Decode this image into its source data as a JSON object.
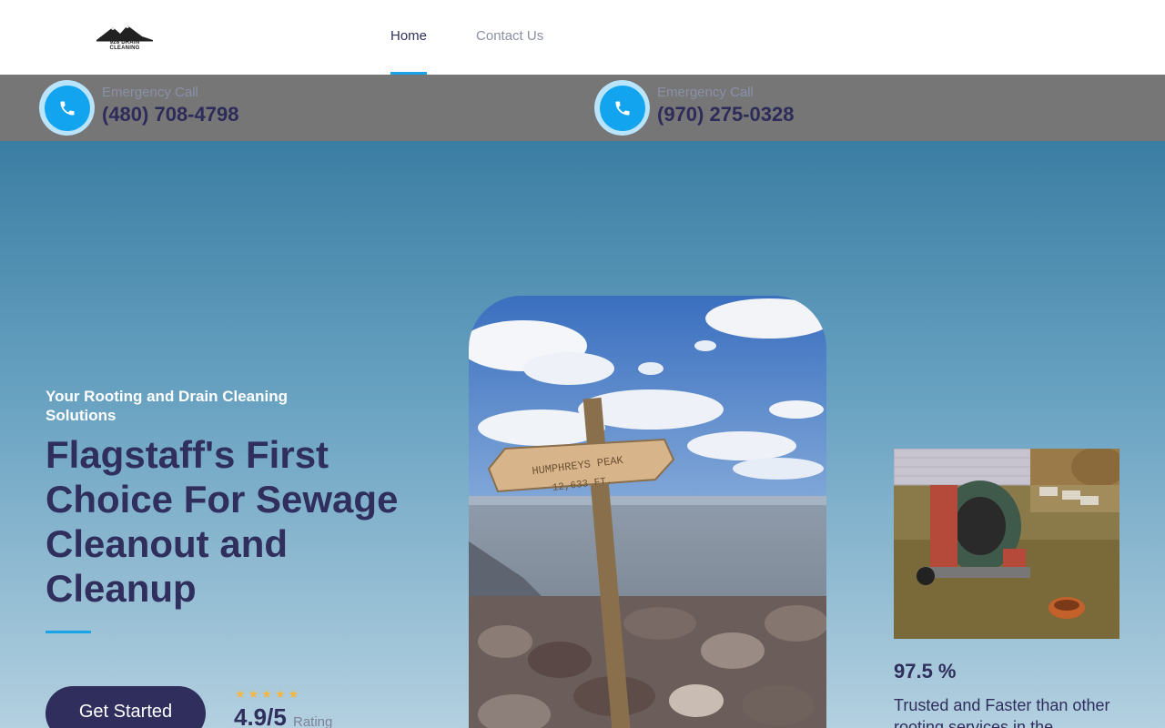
{
  "header": {
    "logo_text": "928 DRAIN CLEANING",
    "nav": [
      {
        "label": "Home",
        "active": true
      },
      {
        "label": "Contact Us",
        "active": false
      }
    ]
  },
  "emergency": [
    {
      "label": "Emergency Call",
      "phone": "(480) 708-4798",
      "icon": "phone-icon"
    },
    {
      "label": "Emergency Call",
      "phone": "(970) 275-0328",
      "icon": "phone-icon"
    }
  ],
  "hero": {
    "subtitle": "Your Rooting and Drain Cleaning Solutions",
    "headline": "Flagstaff's First Choice For Sewage Cleanout and Cleanup",
    "cta_label": "Get Started",
    "rating": {
      "stars": "★★★★★",
      "value": "4.9/5",
      "label": "Rating"
    },
    "main_image_sign": {
      "line1": "HUMPHREYS PEAK",
      "line2": "12,633 FT."
    },
    "stat": {
      "value": "97.5 %",
      "text": "Trusted and Faster than other rooting services in the"
    }
  },
  "colors": {
    "brand_dark": "#2f2e5c",
    "accent_blue": "#1aa3e8",
    "emergency_bar": "#767676",
    "star": "#f4b63f"
  }
}
